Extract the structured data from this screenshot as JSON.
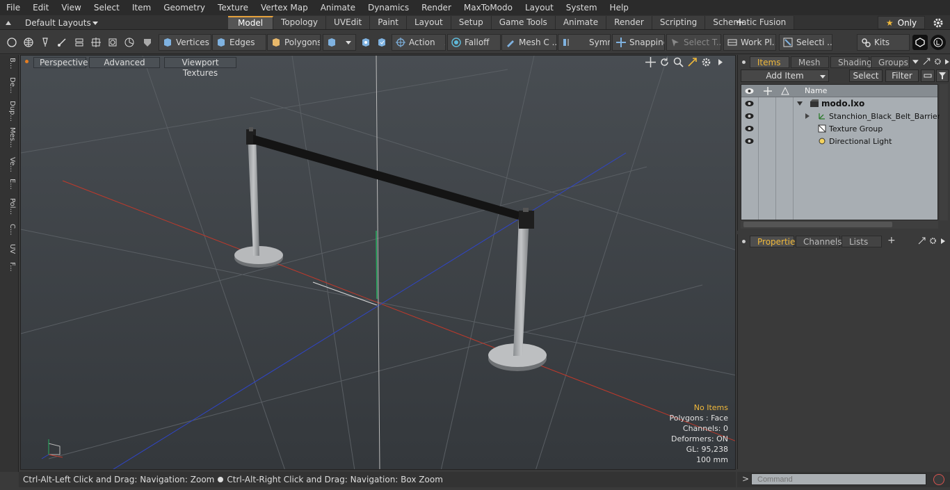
{
  "menubar": [
    "File",
    "Edit",
    "View",
    "Select",
    "Item",
    "Geometry",
    "Texture",
    "Vertex Map",
    "Animate",
    "Dynamics",
    "Render",
    "MaxToModo",
    "Layout",
    "System",
    "Help"
  ],
  "layoutbar": {
    "layout_label": "Default Layouts",
    "tabs": [
      "Model",
      "Topology",
      "UVEdit",
      "Paint",
      "Layout",
      "Setup",
      "Game Tools",
      "Animate",
      "Render",
      "Scripting",
      "Schematic Fusion"
    ],
    "active_tab": "Model",
    "add_tab": "+",
    "only_label": "Only"
  },
  "toolbar": {
    "vertices": "Vertices",
    "edges": "Edges",
    "polygons": "Polygons",
    "action": "Action",
    "action_more": "...",
    "falloff": "Falloff",
    "mesh_c": "Mesh C ...",
    "symm": "Symm ...",
    "snapping": "Snapping",
    "select_t": "Select T...",
    "work_pl": "Work Pl...",
    "selecti": "Selecti ...",
    "kits": "Kits"
  },
  "left_tabs": [
    "B...",
    "De...",
    "Dup...",
    "Mes...",
    "Ve...",
    "E...",
    "Pol...",
    "C...",
    "UV",
    "F..."
  ],
  "viewport": {
    "perspective": "Perspective",
    "advanced": "Advanced",
    "viewport_textures": "Viewport Textures",
    "info": {
      "no_items": "No Items",
      "polygons": "Polygons : Face",
      "channels": "Channels: 0",
      "deformers": "Deformers: ON",
      "gl": "GL: 95,238",
      "scale": "100 mm"
    }
  },
  "statusbar": {
    "hint_left": "Ctrl-Alt-Left Click and Drag: Navigation: Zoom",
    "hint_right": "Ctrl-Alt-Right Click and Drag: Navigation: Box Zoom"
  },
  "items_panel": {
    "tabs": [
      "Items",
      "Mesh ...",
      "Shading",
      "Groups"
    ],
    "active_tab": "Items",
    "add_item": "Add Item",
    "select": "Select",
    "filter": "Filter",
    "column_name": "Name",
    "tree": [
      {
        "label": "modo.lxo",
        "bold": true
      },
      {
        "label": "Stanchion_Black_Belt_Barriers"
      },
      {
        "label": "Texture Group"
      },
      {
        "label": "Directional Light"
      }
    ]
  },
  "props_panel": {
    "tabs": [
      "Properties",
      "Channels",
      "Lists"
    ],
    "active_tab": "Properties",
    "add": "+"
  },
  "command": {
    "placeholder": "Command",
    "prompt": ">"
  },
  "colors": {
    "accent": "#f0b93b",
    "axis_x": "#c0392b",
    "axis_y": "#27ae60",
    "axis_z": "#2f45c9"
  }
}
